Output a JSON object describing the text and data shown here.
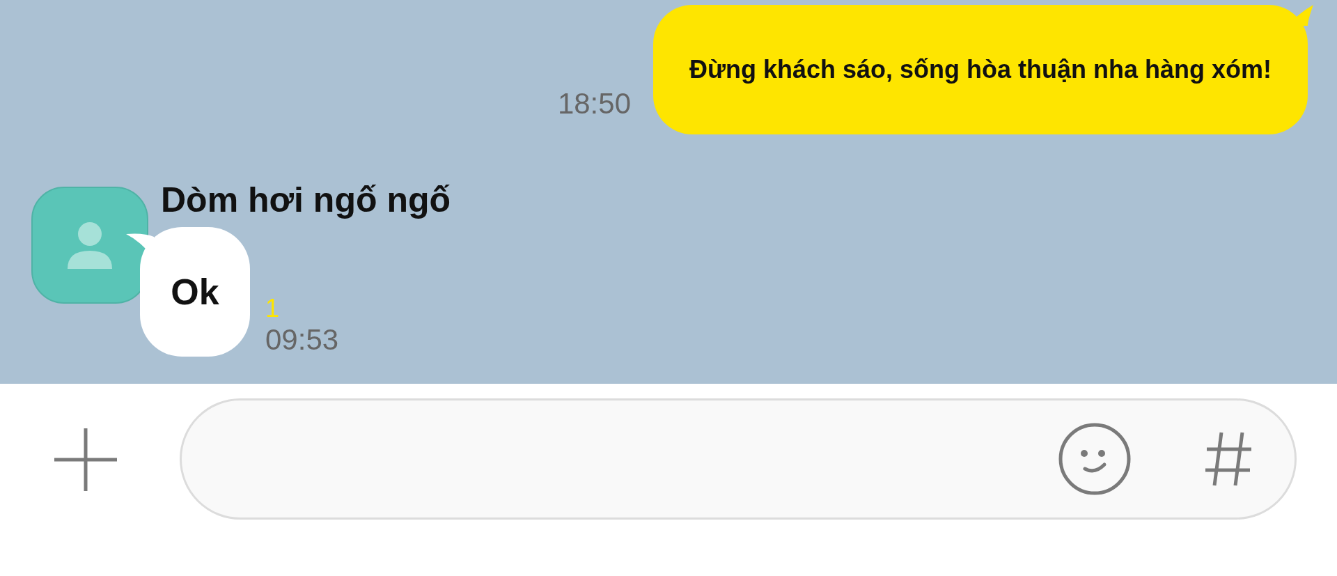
{
  "messages": [
    {
      "kind": "outgoing",
      "text": "Đừng khách sáo, sống hòa thuận nha hàng xóm!",
      "time": "18:50"
    },
    {
      "kind": "incoming",
      "sender": "Dòm hơi ngố ngố",
      "text": "Ok",
      "unread": "1",
      "time": "09:53"
    }
  ]
}
